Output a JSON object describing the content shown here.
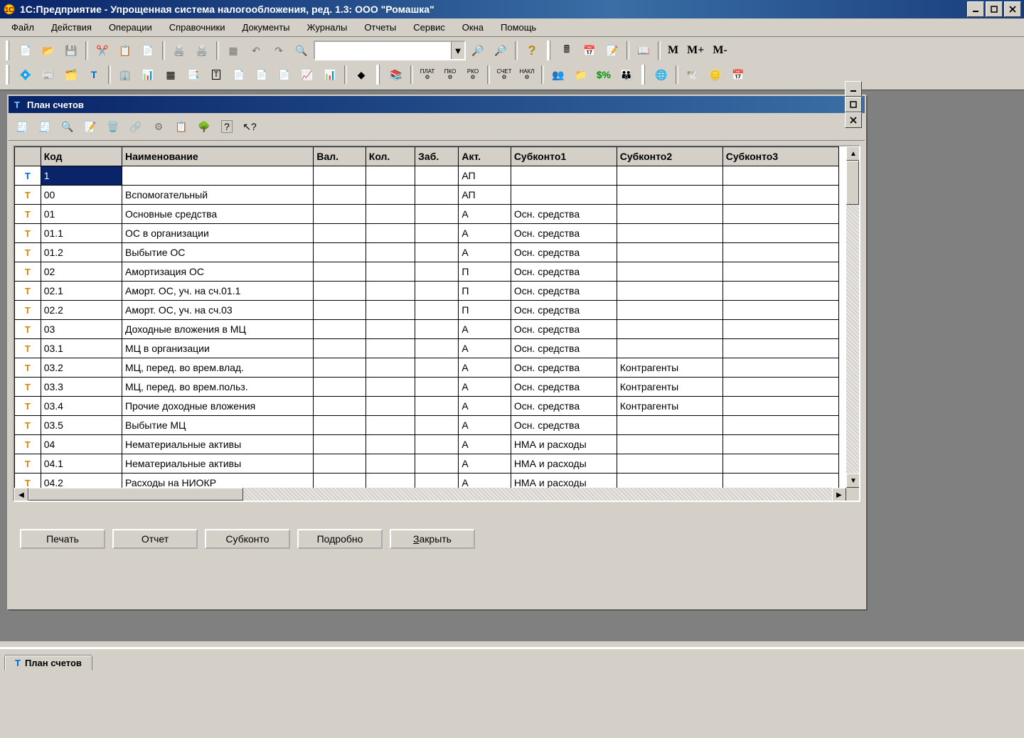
{
  "title": "1С:Предприятие - Упрощенная система налогообложения, ред. 1.3: ООО \"Ромашка\"",
  "menu": [
    "Файл",
    "Действия",
    "Операции",
    "Справочники",
    "Документы",
    "Журналы",
    "Отчеты",
    "Сервис",
    "Окна",
    "Помощь"
  ],
  "mem_buttons": [
    "M",
    "M+",
    "M-"
  ],
  "tb2_labels": {
    "plat": "ПЛАТ",
    "pko": "ПКО",
    "rko": "РКО",
    "schet": "СЧЕТ",
    "nakl": "НАКЛ"
  },
  "child": {
    "title": "План счетов",
    "columns": [
      "",
      "Код",
      "Наименование",
      "Вал.",
      "Кол.",
      "Заб.",
      "Акт.",
      "Субконто1",
      "Субконто2",
      "Субконто3"
    ],
    "rows": [
      {
        "icon": "t",
        "code": "1",
        "name": "",
        "val": "",
        "kol": "",
        "zab": "",
        "akt": "АП",
        "s1": "",
        "s2": "",
        "s3": "",
        "selected": true
      },
      {
        "icon": "s",
        "code": "00",
        "name": "Вспомогательный",
        "val": "",
        "kol": "",
        "zab": "",
        "akt": "АП",
        "s1": "",
        "s2": "",
        "s3": ""
      },
      {
        "icon": "s",
        "code": "01",
        "name": "Основные средства",
        "val": "",
        "kol": "",
        "zab": "",
        "akt": "А",
        "s1": "Осн. средства",
        "s2": "",
        "s3": ""
      },
      {
        "icon": "s",
        "code": "01.1",
        "name": "ОС в организации",
        "val": "",
        "kol": "",
        "zab": "",
        "akt": "А",
        "s1": "Осн. средства",
        "s2": "",
        "s3": ""
      },
      {
        "icon": "s",
        "code": "01.2",
        "name": "Выбытие ОС",
        "val": "",
        "kol": "",
        "zab": "",
        "akt": "А",
        "s1": "Осн. средства",
        "s2": "",
        "s3": ""
      },
      {
        "icon": "s",
        "code": "02",
        "name": "Амортизация ОС",
        "val": "",
        "kol": "",
        "zab": "",
        "akt": "П",
        "s1": "Осн. средства",
        "s2": "",
        "s3": ""
      },
      {
        "icon": "s",
        "code": "02.1",
        "name": "Аморт. ОС, уч. на сч.01.1",
        "val": "",
        "kol": "",
        "zab": "",
        "akt": "П",
        "s1": "Осн. средства",
        "s2": "",
        "s3": ""
      },
      {
        "icon": "s",
        "code": "02.2",
        "name": "Аморт. ОС, уч. на сч.03",
        "val": "",
        "kol": "",
        "zab": "",
        "akt": "П",
        "s1": "Осн. средства",
        "s2": "",
        "s3": ""
      },
      {
        "icon": "s",
        "code": "03",
        "name": "Доходные вложения в МЦ",
        "val": "",
        "kol": "",
        "zab": "",
        "akt": "А",
        "s1": "Осн. средства",
        "s2": "",
        "s3": ""
      },
      {
        "icon": "s",
        "code": "03.1",
        "name": "МЦ в организации",
        "val": "",
        "kol": "",
        "zab": "",
        "akt": "А",
        "s1": "Осн. средства",
        "s2": "",
        "s3": ""
      },
      {
        "icon": "s",
        "code": "03.2",
        "name": "МЦ, перед. во врем.влад.",
        "val": "",
        "kol": "",
        "zab": "",
        "akt": "А",
        "s1": "Осн. средства",
        "s2": "Контрагенты",
        "s3": ""
      },
      {
        "icon": "s",
        "code": "03.3",
        "name": "МЦ, перед. во врем.польз.",
        "val": "",
        "kol": "",
        "zab": "",
        "akt": "А",
        "s1": "Осн. средства",
        "s2": "Контрагенты",
        "s3": ""
      },
      {
        "icon": "s",
        "code": "03.4",
        "name": "Прочие доходные вложения",
        "val": "",
        "kol": "",
        "zab": "",
        "akt": "А",
        "s1": "Осн. средства",
        "s2": "Контрагенты",
        "s3": ""
      },
      {
        "icon": "s",
        "code": "03.5",
        "name": "Выбытие МЦ",
        "val": "",
        "kol": "",
        "zab": "",
        "akt": "А",
        "s1": "Осн. средства",
        "s2": "",
        "s3": ""
      },
      {
        "icon": "s",
        "code": "04",
        "name": "Нематериальные активы",
        "val": "",
        "kol": "",
        "zab": "",
        "akt": "А",
        "s1": "НМА и расходы",
        "s2": "",
        "s3": ""
      },
      {
        "icon": "s",
        "code": "04.1",
        "name": "Нематериальные активы",
        "val": "",
        "kol": "",
        "zab": "",
        "akt": "А",
        "s1": "НМА и расходы",
        "s2": "",
        "s3": ""
      },
      {
        "icon": "s",
        "code": "04.2",
        "name": "Расходы на НИОКР",
        "val": "",
        "kol": "",
        "zab": "",
        "akt": "А",
        "s1": "НМА и расходы",
        "s2": "",
        "s3": ""
      }
    ],
    "buttons": {
      "print": "Печать",
      "report": "Отчет",
      "subkonto": "Субконто",
      "detail": "Подробно",
      "close_prefix": "З",
      "close_rest": "акрыть"
    }
  },
  "window_tab": "План счетов"
}
